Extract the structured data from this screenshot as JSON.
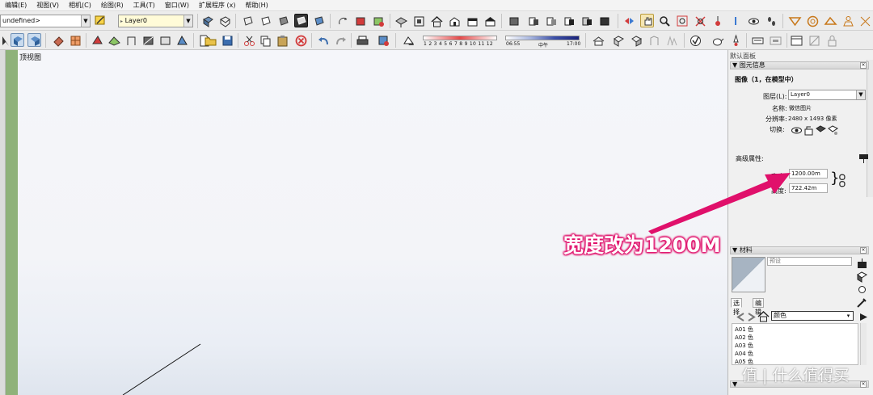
{
  "menu": {
    "items": [
      "编辑(E)",
      "视图(V)",
      "相机(C)",
      "绘图(R)",
      "工具(T)",
      "窗口(W)",
      "扩展程序 (x)",
      "帮助(H)"
    ]
  },
  "toolbar": {
    "style_select": "undefined>",
    "layer_select": "Layer0",
    "shadow_scale_numbers": "1 2 3 4 5 6 7 8 9 10 11 12",
    "shadow_time_start": "06:55",
    "shadow_time_mid": "中午",
    "shadow_time_end": "17:00"
  },
  "canvas": {
    "view_label": "顶视图"
  },
  "panel": {
    "title": "默认面板",
    "entity_info": {
      "header": "图元信息",
      "subject": "图像（1，在模型中）",
      "layer_label": "图层(L):",
      "layer_value": "Layer0",
      "name_label": "名称:",
      "name_value": "微信图片",
      "resolution_label": "分辨率:",
      "resolution_value": "2480 x 1493 像素",
      "toggle_label": "切换:",
      "advanced_label": "高级属性:",
      "width_label": "宽度:",
      "width_value": "1200.00m",
      "height_label": "高度:",
      "height_value": "722.42m"
    },
    "materials": {
      "header": "材料",
      "preset_value": "预设",
      "tab_select": "选择",
      "tab_edit": "编辑",
      "category": "颜色",
      "items": [
        "A01 色",
        "A02 色",
        "A03 色",
        "A04 色",
        "A05 色"
      ]
    }
  },
  "annotation": {
    "text": "宽度改为1200M",
    "color": "#e0106b"
  },
  "watermark": {
    "text": "值 | 什么值得买"
  },
  "colors": {
    "canvas_top": "#f5f6fa",
    "green_strip": "#8fb27a",
    "arrow": "#e0106b"
  }
}
